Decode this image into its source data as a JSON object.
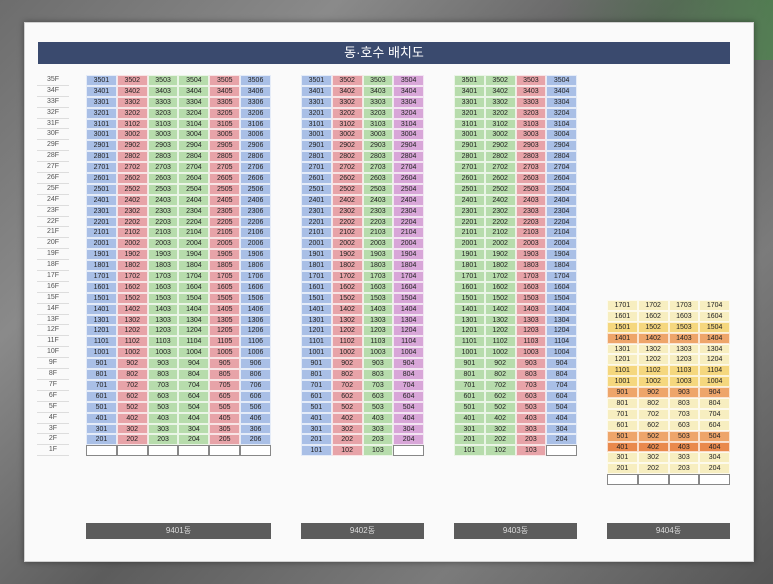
{
  "title": "동·호수 배치도",
  "floors": [
    "35F",
    "34F",
    "33F",
    "32F",
    "31F",
    "30F",
    "29F",
    "28F",
    "27F",
    "26F",
    "25F",
    "24F",
    "23F",
    "22F",
    "21F",
    "20F",
    "19F",
    "18F",
    "17F",
    "16F",
    "15F",
    "14F",
    "13F",
    "12F",
    "11F",
    "10F",
    "9F",
    "8F",
    "7F",
    "6F",
    "5F",
    "4F",
    "3F",
    "2F",
    "1F"
  ],
  "buildings": [
    {
      "name": "9401동",
      "lines": 6,
      "top_floor": 35,
      "first_floor_units": false,
      "line_colors": [
        "blue",
        "red",
        "green",
        "green",
        "red",
        "blue"
      ]
    },
    {
      "name": "9402동",
      "lines": 4,
      "top_floor": 35,
      "first_floor_units": true,
      "line_colors": [
        "blue",
        "red",
        "green",
        "pink"
      ]
    },
    {
      "name": "9403동",
      "lines": 4,
      "top_floor": 35,
      "first_floor_units": true,
      "line_colors": [
        "green",
        "green",
        "red",
        "blue"
      ]
    },
    {
      "name": "9404동",
      "lines": 4,
      "top_floor": 17,
      "first_floor_units": false,
      "row_colors": [
        "light",
        "light",
        "yellow",
        "orange",
        "light",
        "light",
        "yellow",
        "yellow",
        "orange",
        "light",
        "light",
        "light",
        "orange",
        "deep",
        "light",
        "light",
        "yellow",
        "orange"
      ]
    }
  ],
  "colors": {
    "blue": "#a9bfe6",
    "red": "#e7a3a8",
    "green": "#b7dcac",
    "pink": "#d8a6d8",
    "light": "#f7eec0",
    "yellow": "#f5d77e",
    "orange": "#eea56a",
    "deep": "#e9894d"
  }
}
